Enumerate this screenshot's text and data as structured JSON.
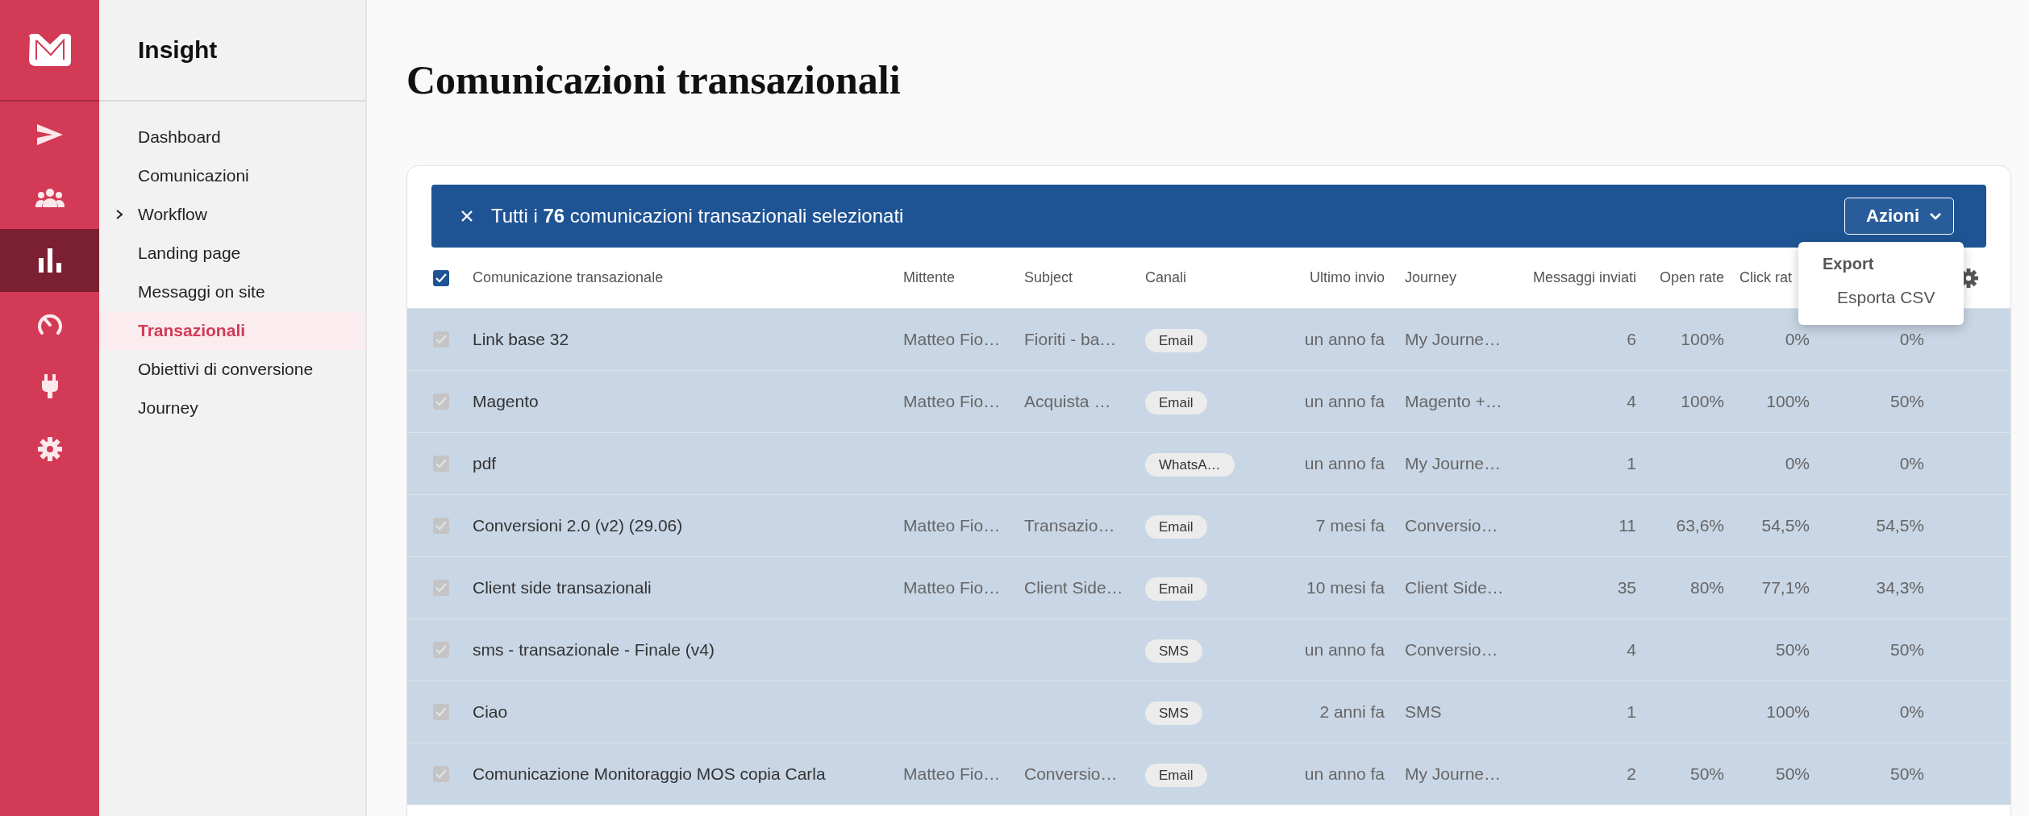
{
  "rail": {
    "items": [
      {
        "selected": false
      },
      {
        "selected": false
      },
      {
        "selected": true
      },
      {
        "selected": false
      },
      {
        "selected": false
      },
      {
        "selected": false
      }
    ]
  },
  "sidebar": {
    "title": "Insight",
    "items": [
      {
        "label": "Dashboard",
        "kind": "link",
        "selected": false
      },
      {
        "label": "Comunicazioni",
        "kind": "link",
        "selected": false
      },
      {
        "label": "Workflow",
        "kind": "group",
        "selected": false
      },
      {
        "label": "Landing page",
        "kind": "link",
        "selected": false
      },
      {
        "label": "Messaggi on site",
        "kind": "link",
        "selected": false
      },
      {
        "label": "Transazionali",
        "kind": "link",
        "selected": true
      },
      {
        "label": "Obiettivi di conversione",
        "kind": "link",
        "selected": false
      },
      {
        "label": "Journey",
        "kind": "link",
        "selected": false
      }
    ]
  },
  "page_title": "Comunicazioni transazionali",
  "selection_bar": {
    "text": "Tutti i **76** comunicazioni transazionali selezionati",
    "actions_button": "Azioni"
  },
  "actions_menu": {
    "section": "Export",
    "items": [
      "Esporta CSV"
    ]
  },
  "table": {
    "all_checked": true,
    "columns": [
      "Comunicazione transazionale",
      "Mittente",
      "Subject",
      "Canali",
      "Ultimo invio",
      "Journey",
      "Messaggi inviati",
      "Open rate",
      "Click rat"
    ],
    "rows": [
      {
        "selected": true,
        "name": "Link base 32",
        "sender": "Matteo Fio…",
        "subject": "Fioriti - ba…",
        "channel": "Email",
        "last_sent": "un anno fa",
        "journey": "My Journe…",
        "sent": "6",
        "open_rate": "100%",
        "click_rate": "0%",
        "column_10": "0%"
      },
      {
        "selected": true,
        "name": "Magento",
        "sender": "Matteo Fio…",
        "subject": "Acquista …",
        "channel": "Email",
        "last_sent": "un anno fa",
        "journey": "Magento +…",
        "sent": "4",
        "open_rate": "100%",
        "click_rate": "100%",
        "column_10": "50%"
      },
      {
        "selected": true,
        "name": "pdf",
        "channel": "WhatsA…",
        "last_sent": "un anno fa",
        "journey": "My Journe…",
        "sent": "1",
        "click_rate": "0%",
        "column_10": "0%"
      },
      {
        "selected": true,
        "name": "Conversioni 2.0 (v2) (29.06)",
        "sender": "Matteo Fio…",
        "subject": "Transazio…",
        "channel": "Email",
        "last_sent": "7 mesi fa",
        "journey": "Conversio…",
        "sent": "11",
        "open_rate": "63,6%",
        "click_rate": "54,5%",
        "column_10": "54,5%"
      },
      {
        "selected": true,
        "name": "Client side transazionali",
        "sender": "Matteo Fio…",
        "subject": "Client Side…",
        "channel": "Email",
        "last_sent": "10 mesi fa",
        "journey": "Client Side…",
        "sent": "35",
        "open_rate": "80%",
        "click_rate": "77,1%",
        "column_10": "34,3%"
      },
      {
        "selected": true,
        "name": "sms - transazionale - Finale (v4)",
        "channel": "SMS",
        "last_sent": "un anno fa",
        "journey": "Conversio…",
        "sent": "4",
        "click_rate": "50%",
        "column_10": "50%"
      },
      {
        "selected": true,
        "name": "Ciao",
        "channel": "SMS",
        "last_sent": "2 anni fa",
        "journey": "SMS",
        "sent": "1",
        "click_rate": "100%",
        "column_10": "0%"
      },
      {
        "selected": true,
        "name": "Comunicazione Monitoraggio MOS copia Carla",
        "sender": "Matteo Fio…",
        "subject": "Conversio…",
        "channel": "Email",
        "last_sent": "un anno fa",
        "journey": "My Journe…",
        "sent": "2",
        "open_rate": "50%",
        "click_rate": "50%",
        "column_10": "50%"
      }
    ]
  }
}
